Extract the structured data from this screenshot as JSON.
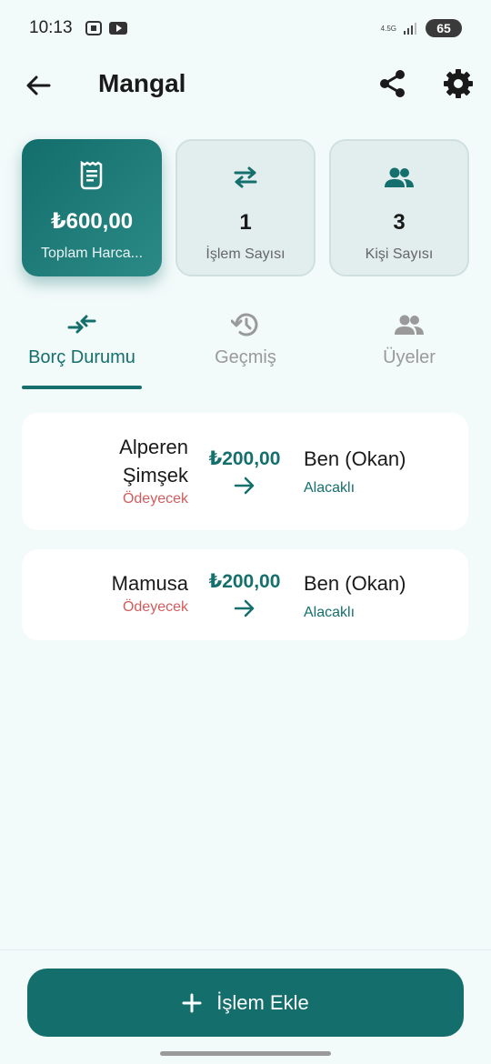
{
  "status_bar": {
    "time": "10:13",
    "network": "4.5G",
    "battery": "65"
  },
  "app_bar": {
    "title": "Mangal"
  },
  "stats": [
    {
      "value": "₺600,00",
      "label": "Toplam Harca...",
      "icon": "receipt-icon"
    },
    {
      "value": "1",
      "label": "İşlem Sayısı",
      "icon": "swap-icon"
    },
    {
      "value": "3",
      "label": "Kişi Sayısı",
      "icon": "people-icon"
    }
  ],
  "tabs": [
    {
      "label": "Borç Durumu",
      "icon": "compare-arrows-icon",
      "active": true
    },
    {
      "label": "Geçmiş",
      "icon": "history-icon",
      "active": false
    },
    {
      "label": "Üyeler",
      "icon": "people-icon",
      "active": false
    }
  ],
  "debts": [
    {
      "debtor_line1": "Alperen",
      "debtor_line2": "Şimşek",
      "debtor_status": "Ödeyecek",
      "amount": "₺200,00",
      "creditor": "Ben (Okan)",
      "creditor_status": "Alacaklı"
    },
    {
      "debtor_line1": "Mamusa",
      "debtor_line2": "",
      "debtor_status": "Ödeyecek",
      "amount": "₺200,00",
      "creditor": "Ben (Okan)",
      "creditor_status": "Alacaklı"
    }
  ],
  "add_button": {
    "label": "İşlem Ekle",
    "icon": "plus-icon"
  },
  "colors": {
    "primary": "#136e6c",
    "background": "#f3fafa",
    "debtor_status": "#d25c5c"
  }
}
